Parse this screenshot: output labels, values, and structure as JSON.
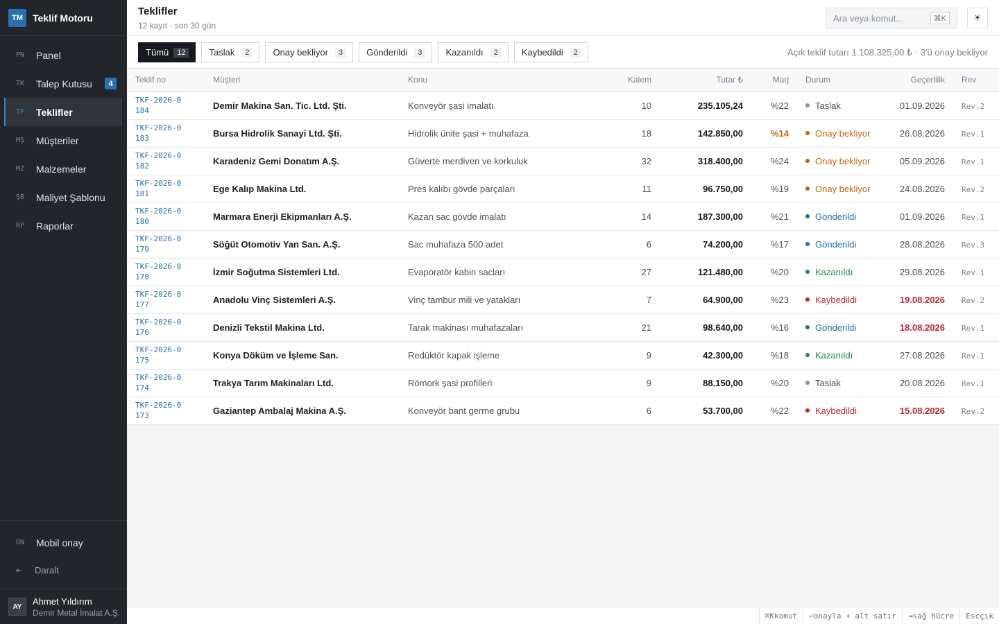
{
  "app": {
    "logo": "TM",
    "name": "Teklif Motoru"
  },
  "nav": [
    {
      "abbr": "PN",
      "label": "Panel"
    },
    {
      "abbr": "TK",
      "label": "Talep Kutusu",
      "badge": "4"
    },
    {
      "abbr": "TF",
      "label": "Teklifler",
      "active": true
    },
    {
      "abbr": "MŞ",
      "label": "Müşteriler"
    },
    {
      "abbr": "MZ",
      "label": "Malzemeler"
    },
    {
      "abbr": "ŞB",
      "label": "Maliyet Şablonu"
    },
    {
      "abbr": "RP",
      "label": "Raporlar"
    }
  ],
  "mobile": {
    "abbr": "ON",
    "label": "Mobil onay"
  },
  "collapse": {
    "icon": "⇤",
    "label": "Daralt"
  },
  "user": {
    "initials": "AY",
    "name": "Ahmet Yıldırım",
    "company": "Demir Metal İmalat A.Ş."
  },
  "header": {
    "title": "Teklifler",
    "subtitle": "12 kayıt · son 30 gün",
    "search_placeholder": "Ara veya komut...",
    "search_kbd": "⌘K",
    "theme_icon": "☀"
  },
  "tabs": [
    {
      "label": "Tümü",
      "count": "12",
      "active": true
    },
    {
      "label": "Taslak",
      "count": "2"
    },
    {
      "label": "Onay bekliyor",
      "count": "3"
    },
    {
      "label": "Gönderildi",
      "count": "3"
    },
    {
      "label": "Kazanıldı",
      "count": "2"
    },
    {
      "label": "Kaybedildi",
      "count": "2"
    }
  ],
  "summary": "Açık teklif tutarı 1.108.325,00 ₺ · 3'ü onay bekliyor",
  "columns": {
    "no": "Teklif no",
    "customer": "Müşteri",
    "subject": "Konu",
    "items": "Kalem",
    "amount": "Tutar ₺",
    "margin": "Marj",
    "status": "Durum",
    "validity": "Geçerlilik",
    "rev": "Rev"
  },
  "status_colors": {
    "Taslak": "#8a9097",
    "Onay bekliyor": "#c2650a",
    "Gönderildi": "#1f6aa8",
    "Kazanıldı": "#1f8a45",
    "Kaybedildi": "#c0262d"
  },
  "rows": [
    {
      "no": "TKF-2026-0184",
      "customer": "Demir Makina San. Tic. Ltd. Şti.",
      "subject": "Konveyör şasi imalatı",
      "items": "10",
      "amount": "235.105,24",
      "margin": "%22",
      "status": "Taslak",
      "validity": "01.09.2026",
      "rev": "Rev.2"
    },
    {
      "no": "TKF-2026-0183",
      "customer": "Bursa Hidrolik Sanayi Ltd. Şti.",
      "subject": "Hidrolik ünite şasi + muhafaza",
      "items": "18",
      "amount": "142.850,00",
      "margin": "%14",
      "margin_low": true,
      "status": "Onay bekliyor",
      "validity": "26.08.2026",
      "rev": "Rev.1"
    },
    {
      "no": "TKF-2026-0182",
      "customer": "Karadeniz Gemi Donatım A.Ş.",
      "subject": "Güverte merdiven ve korkuluk",
      "items": "32",
      "amount": "318.400,00",
      "margin": "%24",
      "status": "Onay bekliyor",
      "validity": "05.09.2026",
      "rev": "Rev.1"
    },
    {
      "no": "TKF-2026-0181",
      "customer": "Ege Kalıp Makina Ltd.",
      "subject": "Pres kalıbı gövde parçaları",
      "items": "11",
      "amount": "96.750,00",
      "margin": "%19",
      "status": "Onay bekliyor",
      "validity": "24.08.2026",
      "rev": "Rev.2"
    },
    {
      "no": "TKF-2026-0180",
      "customer": "Marmara Enerji Ekipmanları A.Ş.",
      "subject": "Kazan sac gövde imalatı",
      "items": "14",
      "amount": "187.300,00",
      "margin": "%21",
      "status": "Gönderildi",
      "validity": "01.09.2026",
      "rev": "Rev.1"
    },
    {
      "no": "TKF-2026-0179",
      "customer": "Söğüt Otomotiv Yan San. A.Ş.",
      "subject": "Sac muhafaza 500 adet",
      "items": "6",
      "amount": "74.200,00",
      "margin": "%17",
      "status": "Gönderildi",
      "validity": "28.08.2026",
      "rev": "Rev.3"
    },
    {
      "no": "TKF-2026-0178",
      "customer": "İzmir Soğutma Sistemleri Ltd.",
      "subject": "Evaporatör kabin sacları",
      "items": "27",
      "amount": "121.480,00",
      "margin": "%20",
      "status": "Kazanıldı",
      "validity": "29.08.2026",
      "rev": "Rev.1"
    },
    {
      "no": "TKF-2026-0177",
      "customer": "Anadolu Vinç Sistemleri A.Ş.",
      "subject": "Vinç tambur mili ve yatakları",
      "items": "7",
      "amount": "64.900,00",
      "margin": "%23",
      "status": "Kaybedildi",
      "validity": "19.08.2026",
      "validity_expired": true,
      "rev": "Rev.2"
    },
    {
      "no": "TKF-2026-0176",
      "customer": "Denizli Tekstil Makina Ltd.",
      "subject": "Tarak makinası muhafazaları",
      "items": "21",
      "amount": "98.640,00",
      "margin": "%16",
      "status": "Gönderildi",
      "validity": "18.08.2026",
      "validity_expired": true,
      "rev": "Rev.1"
    },
    {
      "no": "TKF-2026-0175",
      "customer": "Konya Döküm ve İşleme San.",
      "subject": "Redüktör kapak işleme",
      "items": "9",
      "amount": "42.300,00",
      "margin": "%18",
      "status": "Kazanıldı",
      "validity": "27.08.2026",
      "rev": "Rev.1"
    },
    {
      "no": "TKF-2026-0174",
      "customer": "Trakya Tarım Makinaları Ltd.",
      "subject": "Römork şasi profilleri",
      "items": "9",
      "amount": "88.150,00",
      "margin": "%20",
      "status": "Taslak",
      "validity": "20.08.2026",
      "rev": "Rev.1"
    },
    {
      "no": "TKF-2026-0173",
      "customer": "Gaziantep Ambalaj Makina A.Ş.",
      "subject": "Konveyör bant germe grubu",
      "items": "6",
      "amount": "53.700,00",
      "margin": "%22",
      "status": "Kaybedildi",
      "validity": "15.08.2026",
      "validity_expired": true,
      "rev": "Rev.2"
    }
  ],
  "shortcuts": [
    {
      "key": "⌘K",
      "label": "komut"
    },
    {
      "key": "⏎",
      "label": "onayla + alt satır"
    },
    {
      "key": "⇥",
      "label": "sağ hücre"
    },
    {
      "key": "Esc",
      "label": "çık"
    }
  ]
}
